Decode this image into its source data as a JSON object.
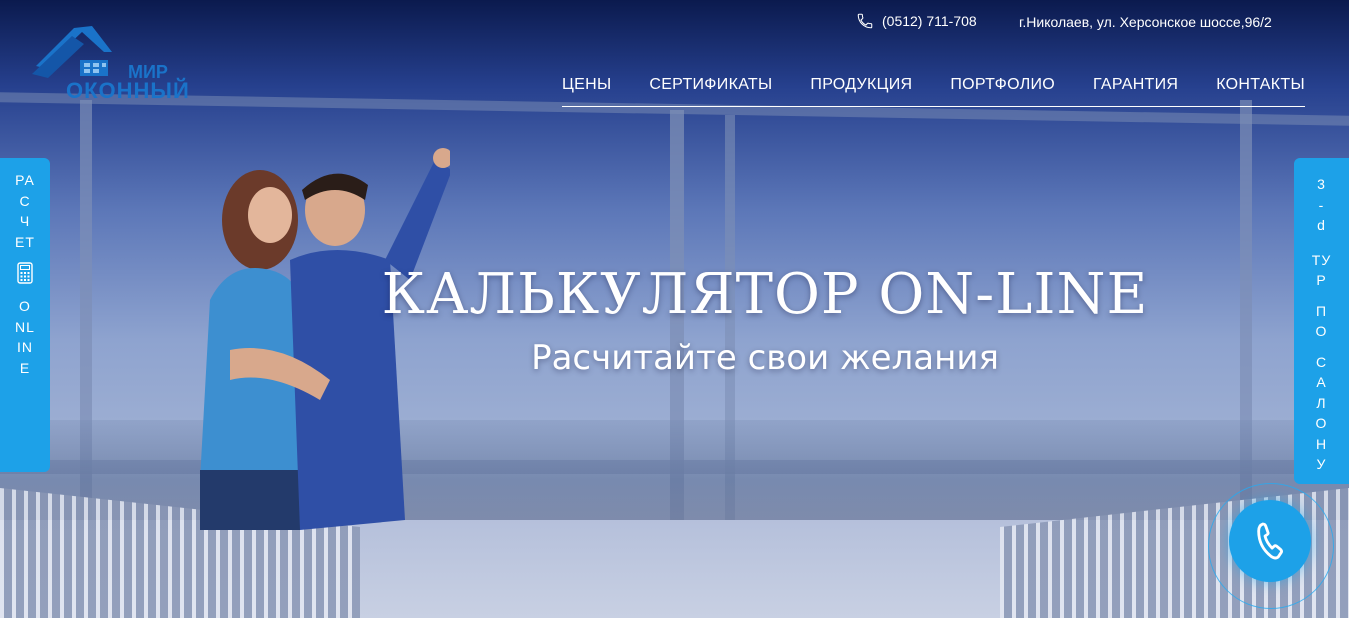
{
  "header": {
    "phone": "(0512) 711-708",
    "address": "г.Николаев, ул. Херсонское шоссе,96/2"
  },
  "logo": {
    "line1": "МИР",
    "line2": "ОКОННЫЙ"
  },
  "nav": {
    "items": [
      "ЦЕНЫ",
      "СЕРТИФИКАТЫ",
      "ПРОДУКЦИЯ",
      "ПОРТФОЛИО",
      "ГАРАНТИЯ",
      "КОНТАКТЫ"
    ]
  },
  "hero": {
    "title": "КАЛЬКУЛЯТОР ON-LINE",
    "subtitle": "Расчитайте свои желания"
  },
  "side_left": {
    "top": "РАСЧЕТ",
    "bottom": "ONLINE",
    "icon": "calculator-icon"
  },
  "side_right": {
    "line1": "3-d",
    "line2": "ТУР",
    "line3": "ПО",
    "line4": "САЛОНУ"
  },
  "call_button": {
    "icon": "phone-icon"
  },
  "colors": {
    "accent": "#1da1e8",
    "logo": "#1a73c9",
    "text": "#ffffff"
  }
}
